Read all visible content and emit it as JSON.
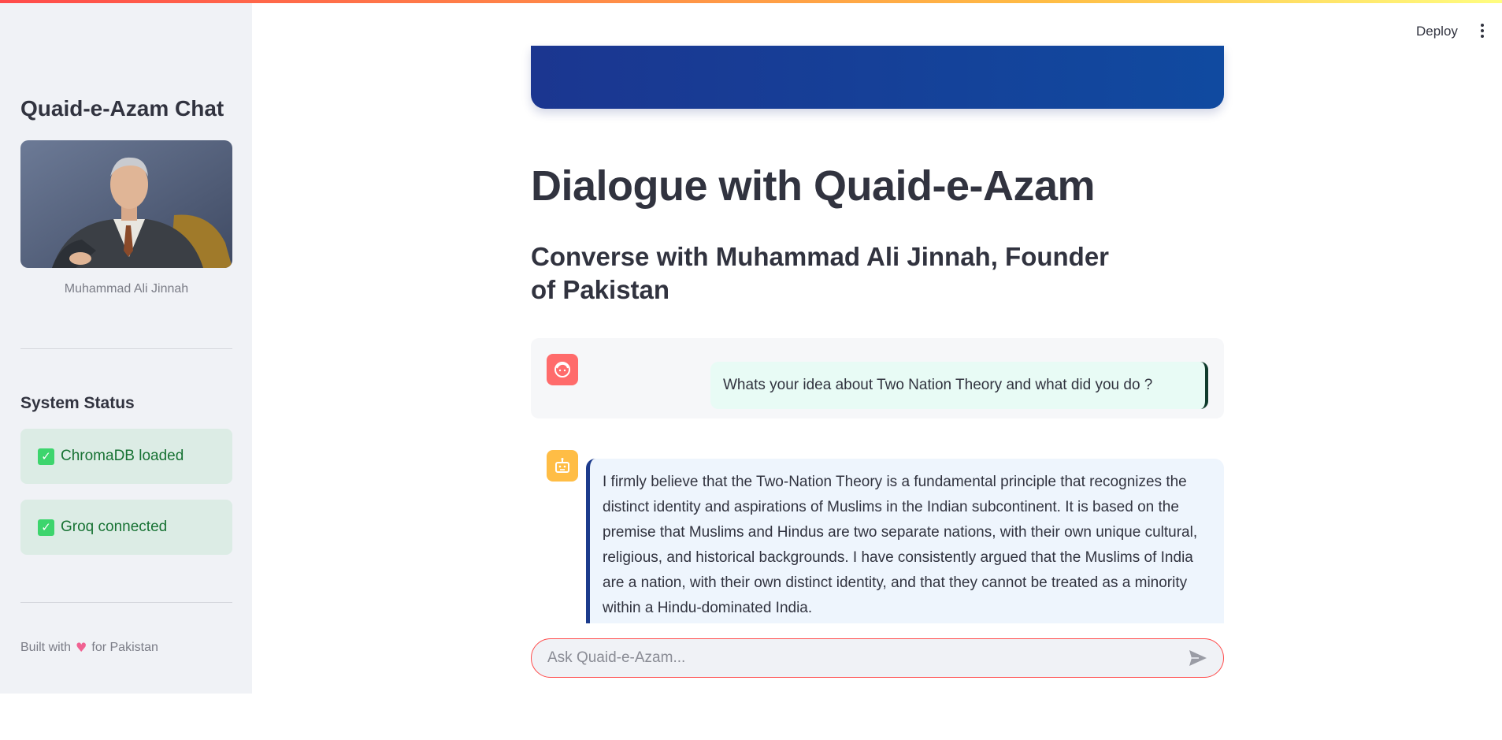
{
  "header": {
    "deploy_label": "Deploy",
    "menu_icon": "vertical-dots-icon"
  },
  "sidebar": {
    "title": "Quaid-e-Azam Chat",
    "portrait_caption": "Muhammad Ali Jinnah",
    "status_heading": "System Status",
    "status_items": [
      {
        "icon": "check-icon",
        "label": "ChromaDB loaded"
      },
      {
        "icon": "check-icon",
        "label": "Groq connected"
      }
    ],
    "footer": {
      "prefix": "Built with",
      "icon": "heart-icon",
      "suffix": "for Pakistan"
    }
  },
  "main": {
    "title": "Dialogue with Quaid-e-Azam",
    "subtitle": "Converse with Muhammad Ali Jinnah, Founder of Pakistan",
    "messages": [
      {
        "role": "user",
        "avatar": "user-face-icon",
        "text": "Whats your idea about Two Nation Theory and what did you do ?"
      },
      {
        "role": "assistant",
        "avatar": "robot-icon",
        "text": "I firmly believe that the Two-Nation Theory is a fundamental principle that recognizes the distinct identity and aspirations of Muslims in the Indian subcontinent. It is based on the premise that Muslims and Hindus are two separate nations, with their own unique cultural, religious, and historical backgrounds. I have consistently argued that the Muslims of India are a nation, with their own distinct identity, and that they cannot be treated as a minority within a Hindu-dominated India."
      }
    ],
    "chat_input": {
      "placeholder": "Ask Quaid-e-Azam...",
      "value": "",
      "send_icon": "send-icon"
    }
  },
  "colors": {
    "accent": "#ff4b4b",
    "banner": "#1b3690",
    "success_bg": "#dcece5",
    "success_text": "#177233"
  }
}
